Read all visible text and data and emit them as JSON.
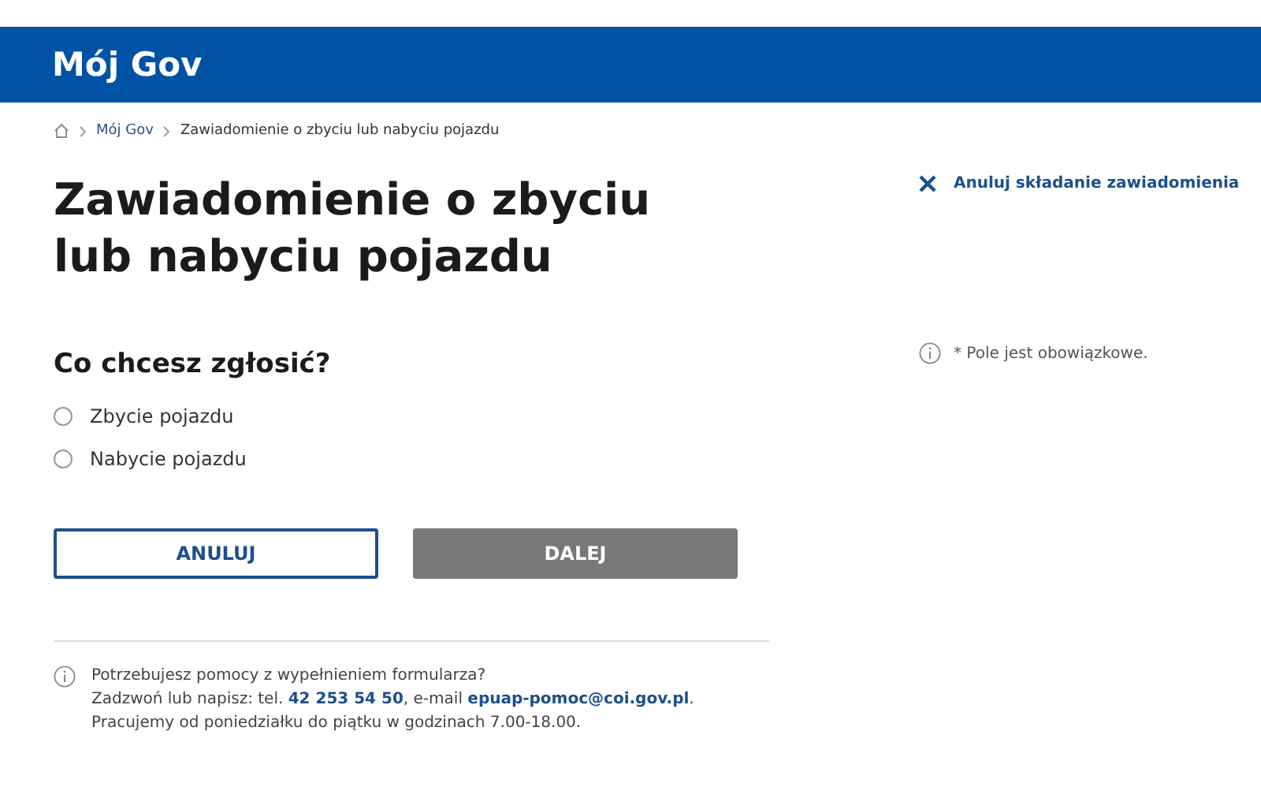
{
  "header": {
    "logo": "Mój Gov"
  },
  "breadcrumb": [
    {
      "label": "Mój Gov",
      "link": true
    },
    {
      "label": "Zawiadomienie o zbyciu lub nabyciu pojazdu",
      "link": false
    }
  ],
  "title": "Zawiadomienie o zbyciu lub nabyciu pojazdu",
  "cancel_link": "Anuluj składanie zawiadomienia",
  "required_note": "* Pole jest obowiązkowe.",
  "question": "Co chcesz zgłosić?",
  "options": [
    {
      "label": "Zbycie pojazdu",
      "selected": false
    },
    {
      "label": "Nabycie pojazdu",
      "selected": false
    }
  ],
  "buttons": [
    {
      "label": "ANULUJ",
      "kind": "outline",
      "disabled": false
    },
    {
      "label": "DALEJ",
      "kind": "primary",
      "disabled": true
    }
  ],
  "help": {
    "question": "Potrzebujesz pomocy z wypełnieniem formularza?",
    "contact_prefix": "Zadzwoń lub napisz: tel.",
    "phone": "42 253 54 50",
    "contact_middle": ", e-mail",
    "email": "epuap-pomoc@coi.gov.pl",
    "contact_suffix": ".",
    "hours": "Pracujemy od poniedziałku do piątku w godzinach 7.00-18.00."
  }
}
